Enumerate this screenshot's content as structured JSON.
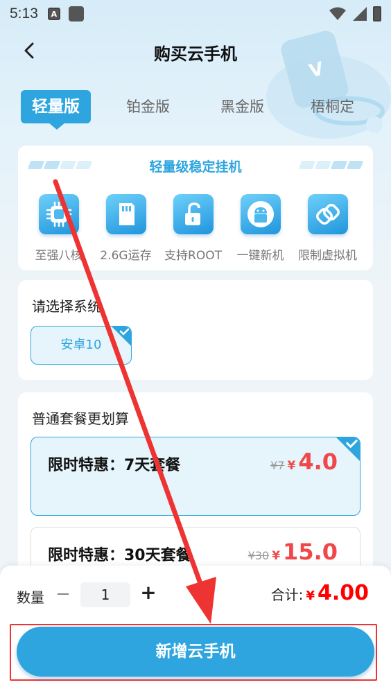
{
  "status_bar": {
    "time": "5:13",
    "notification_letter": "A"
  },
  "header": {
    "title": "购买云手机",
    "back_icon": "chevron-left-icon"
  },
  "tabs": [
    {
      "label": "轻量版",
      "active": true
    },
    {
      "label": "铂金版",
      "active": false
    },
    {
      "label": "黑金版",
      "active": false
    },
    {
      "label": "梧桐定",
      "active": false
    }
  ],
  "features": {
    "title": "轻量级稳定挂机",
    "items": [
      {
        "label": "至强八核",
        "icon": "cpu-icon"
      },
      {
        "label": "2.6G运存",
        "icon": "sd-card-icon"
      },
      {
        "label": "支持ROOT",
        "icon": "unlock-icon"
      },
      {
        "label": "一键新机",
        "icon": "android-icon"
      },
      {
        "label": "限制虚拟机",
        "icon": "link-icon"
      }
    ]
  },
  "system": {
    "title": "请选择系统",
    "options": [
      {
        "label": "安卓10",
        "selected": true
      }
    ]
  },
  "packages": {
    "title": "普通套餐更划算",
    "items": [
      {
        "name": "限时特惠：7天套餐",
        "old_price": "¥7",
        "currency": "¥",
        "price": "4.0",
        "selected": true
      },
      {
        "name": "限时特惠：30天套餐",
        "old_price": "¥30",
        "currency": "¥",
        "price": "15.0",
        "selected": false
      }
    ]
  },
  "bottom_bar": {
    "quantity_label": "数量",
    "quantity": "1",
    "minus": "−",
    "plus": "+",
    "total_label": "合计:",
    "total_currency": "¥",
    "total_value": "4.00",
    "cta_label": "新增云手机"
  },
  "colors": {
    "accent": "#2ea5df",
    "price": "#f04848",
    "annotation": "#e33333"
  }
}
